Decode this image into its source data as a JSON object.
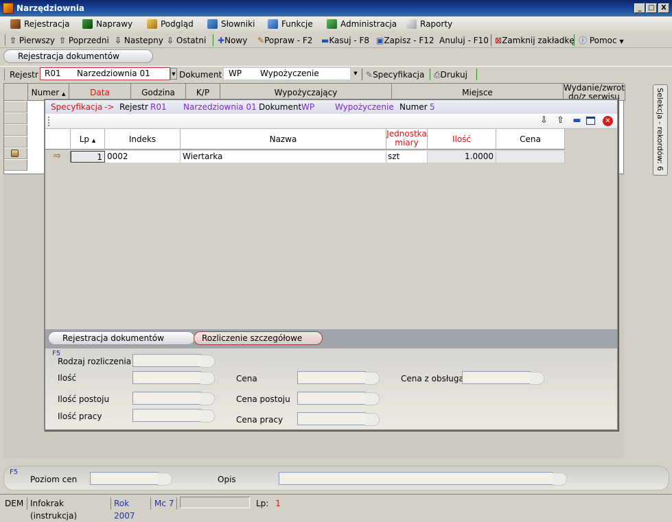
{
  "window": {
    "title": "Narzędziownia",
    "btn_min": "_",
    "btn_max": "□",
    "btn_close": "X"
  },
  "menu": {
    "items": [
      {
        "label": "Rejestracja"
      },
      {
        "label": "Naprawy"
      },
      {
        "label": "Podgląd"
      },
      {
        "label": "Słowniki"
      },
      {
        "label": "Funkcje"
      },
      {
        "label": "Administracja"
      },
      {
        "label": "Raporty"
      }
    ]
  },
  "toolbar": {
    "first": "Pierwszy",
    "prev": "Poprzedni",
    "next": "Nastepny",
    "last": "Ostatni",
    "new": "Nowy",
    "edit": "Popraw - F2",
    "delete": "Kasuj - F8",
    "save": "Zapisz - F12",
    "cancel": "Anuluj - F10",
    "close_tab": "Zamknij zakładkę",
    "help": "Pomoc"
  },
  "tabs": {
    "main": "Rejestracja dokumentów"
  },
  "register": {
    "label": "Rejestr",
    "code": "R01",
    "name": "Narzedziownia 01",
    "doc_label": "Dokument",
    "doc_code": "WP",
    "doc_name": "Wypożyczenie",
    "spec": "Specyfikacja",
    "print": "Drukuj"
  },
  "grid": {
    "columns": [
      "Numer",
      "Data",
      "Godzina",
      "K/P",
      "Wypożyczający",
      "Miejsce",
      "Wydanie/zwrot do/z serwisu"
    ]
  },
  "side_label": "Selekcja - rekordów: 6",
  "panel": {
    "hdr_spec": "Specyfikacja",
    "hdr_arrow": "->",
    "hdr_reg_label": "Rejestr",
    "hdr_reg_code": "R01",
    "hdr_reg_name": "Narzedziownia 01",
    "hdr_doc_label": "Dokument",
    "hdr_doc_code": "WP",
    "hdr_doc_name": "Wypożyczenie",
    "hdr_num_label": "Numer",
    "hdr_num": "5",
    "columns": {
      "lp": "Lp",
      "indeks": "Indeks",
      "nazwa": "Nazwa",
      "jm": "Jednostka miary",
      "ilosc": "Ilość",
      "cena": "Cena"
    },
    "rows": [
      {
        "lp": "1",
        "indeks": "0002",
        "nazwa": "Wiertarka",
        "jm": "szt",
        "ilosc": "1.0000",
        "cena": ""
      }
    ],
    "tabs": [
      "Rejestracja dokumentów",
      "Rozliczenie szczegółowe"
    ],
    "form": {
      "f5": "F5",
      "rodzaj": "Rodzaj rozliczenia",
      "ilosc": "Ilość",
      "ilosc_postoju": "Ilość postoju",
      "ilosc_pracy": "Ilość pracy",
      "cena": "Cena",
      "cena_postoju": "Cena postoju",
      "cena_pracy": "Cena pracy",
      "cena_obsluga": "Cena z obsługą"
    }
  },
  "bottom": {
    "f5": "F5",
    "poziom": "Poziom cen",
    "opis": "Opis"
  },
  "status": {
    "dem": "DEM",
    "user": "Infokrak (instrukcja)",
    "rok": "Rok 2007",
    "mc": "Mc 7",
    "lp_label": "Lp:",
    "lp_value": "1"
  },
  "colors": {
    "accent_red": "#e01010",
    "purple": "#7a2acc",
    "title_blue": "#0a246a"
  }
}
